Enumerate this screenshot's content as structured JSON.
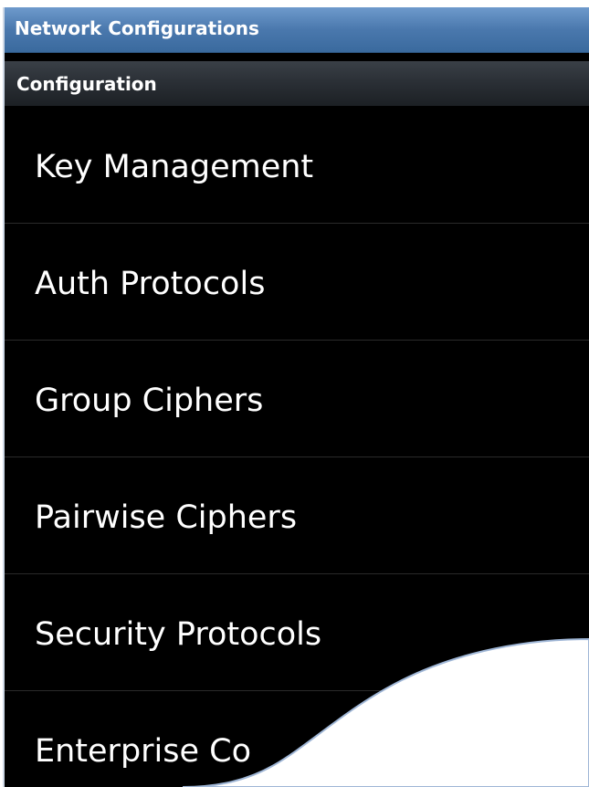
{
  "header": {
    "title": "Network Configurations"
  },
  "section": {
    "title": "Configuration"
  },
  "list": {
    "items": [
      {
        "label": "Key Management"
      },
      {
        "label": "Auth Protocols"
      },
      {
        "label": "Group Ciphers"
      },
      {
        "label": "Pairwise Ciphers"
      },
      {
        "label": "Security Protocols"
      },
      {
        "label": "Enterprise Co"
      }
    ]
  },
  "colors": {
    "titlebar": "#4a78ad",
    "background": "#000000",
    "text": "#ffffff",
    "divider": "#2a2a2a"
  }
}
